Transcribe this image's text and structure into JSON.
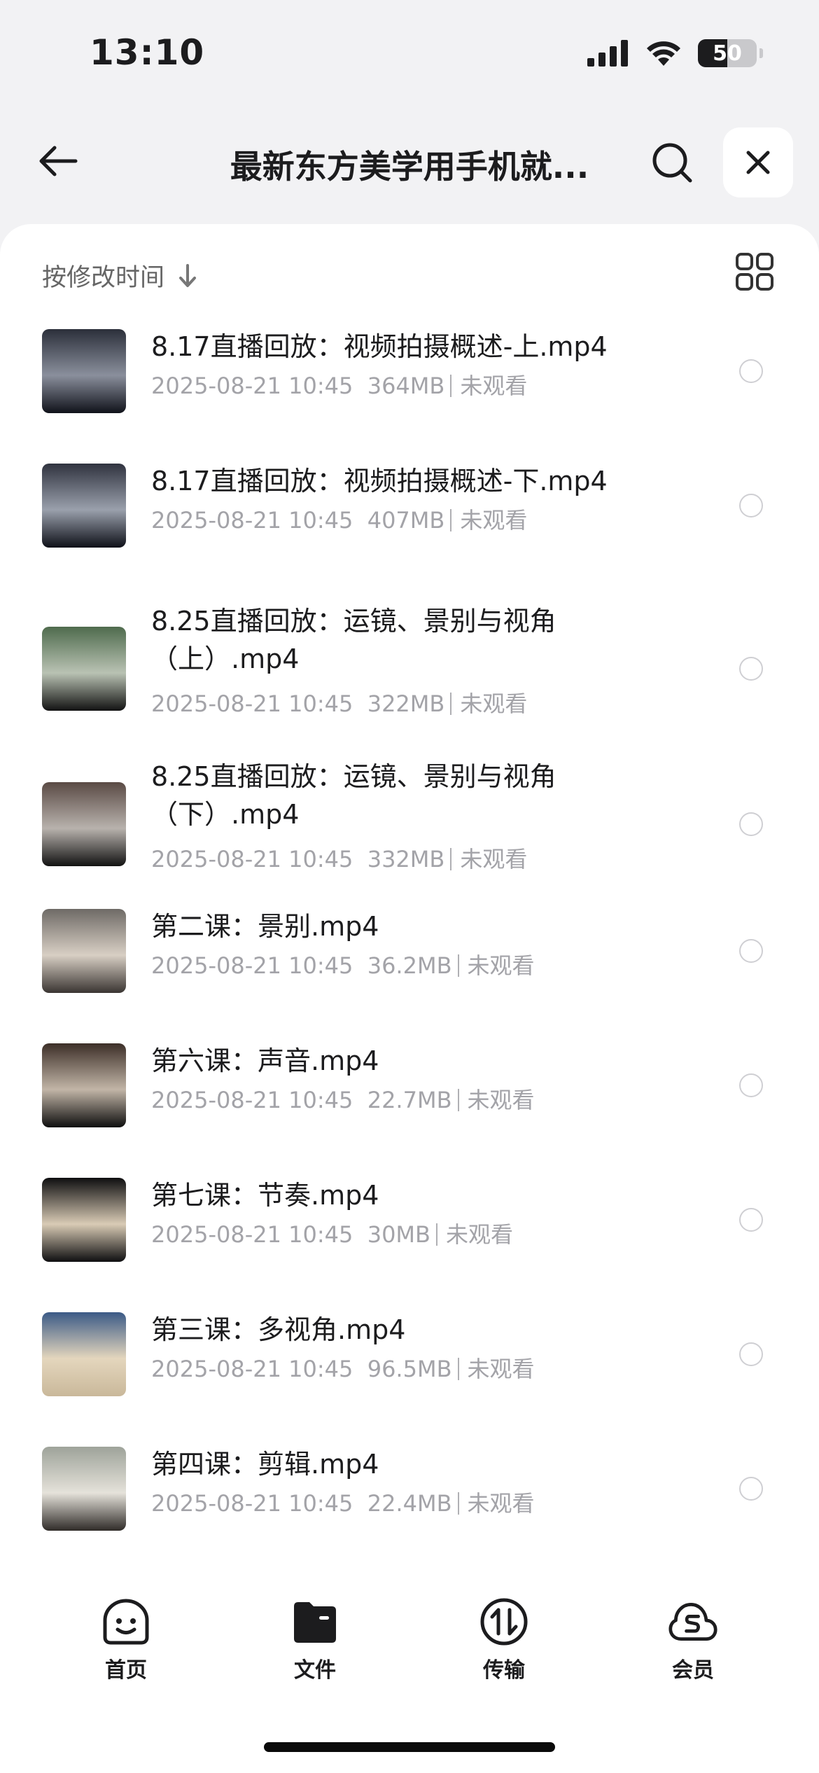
{
  "status_bar": {
    "time": "13:10",
    "battery_text": "50",
    "battery_level": 0.5
  },
  "nav": {
    "title": "最新东方美学用手机就...",
    "icons": {
      "back": "arrow-left-icon",
      "search": "search-icon",
      "close": "close-icon"
    }
  },
  "toolbar": {
    "sort_label": "按修改时间",
    "sort_icon": "arrow-down-icon",
    "view_icon": "grid-view-icon"
  },
  "files": [
    {
      "name": "8.17直播回放：视频拍摄概述-上.mp4",
      "date": "2025-08-21 10:45",
      "size": "364MB",
      "status": "未观看",
      "thumb_colors": [
        "#2b2f3a",
        "#8a8f9c",
        "#10121a"
      ]
    },
    {
      "name": "8.17直播回放：视频拍摄概述-下.mp4",
      "date": "2025-08-21 10:45",
      "size": "407MB",
      "status": "未观看",
      "thumb_colors": [
        "#30333f",
        "#9aa0ac",
        "#0e1018"
      ]
    },
    {
      "name": "8.25直播回放：运镜、景别与视角（上）.mp4",
      "date": "2025-08-21 10:45",
      "size": "322MB",
      "status": "未观看",
      "thumb_colors": [
        "#4f6b4d",
        "#b9c2b3",
        "#121212"
      ]
    },
    {
      "name": "8.25直播回放：运镜、景别与视角（下）.mp4",
      "date": "2025-08-21 10:45",
      "size": "332MB",
      "status": "未观看",
      "thumb_colors": [
        "#5a4a44",
        "#b8b2ad",
        "#121212"
      ]
    },
    {
      "name": "第二课：景别.mp4",
      "date": "2025-08-21 10:45",
      "size": "36.2MB",
      "status": "未观看",
      "thumb_colors": [
        "#6e6a66",
        "#d8cfc4",
        "#3a3532"
      ]
    },
    {
      "name": "第六课：声音.mp4",
      "date": "2025-08-21 10:45",
      "size": "22.7MB",
      "status": "未观看",
      "thumb_colors": [
        "#3c2f28",
        "#c2b5a7",
        "#0e0e0e"
      ]
    },
    {
      "name": "第七课：节奏.mp4",
      "date": "2025-08-21 10:45",
      "size": "30MB",
      "status": "未观看",
      "thumb_colors": [
        "#0e0e10",
        "#d9cbb5",
        "#0e0e10"
      ]
    },
    {
      "name": "第三课：多视角.mp4",
      "date": "2025-08-21 10:45",
      "size": "96.5MB",
      "status": "未观看",
      "thumb_colors": [
        "#3b5a86",
        "#e4d6bd",
        "#c9b89a"
      ]
    },
    {
      "name": "第四课：剪辑.mp4",
      "date": "2025-08-21 10:45",
      "size": "22.4MB",
      "status": "未观看",
      "thumb_colors": [
        "#9ea39a",
        "#e5e2da",
        "#2f2b28"
      ]
    }
  ],
  "tabbar": [
    {
      "label": "首页",
      "icon": "smile-face-icon"
    },
    {
      "label": "文件",
      "icon": "folder-icon"
    },
    {
      "label": "传输",
      "icon": "transfer-icon"
    },
    {
      "label": "会员",
      "icon": "cloud-s-icon"
    }
  ]
}
